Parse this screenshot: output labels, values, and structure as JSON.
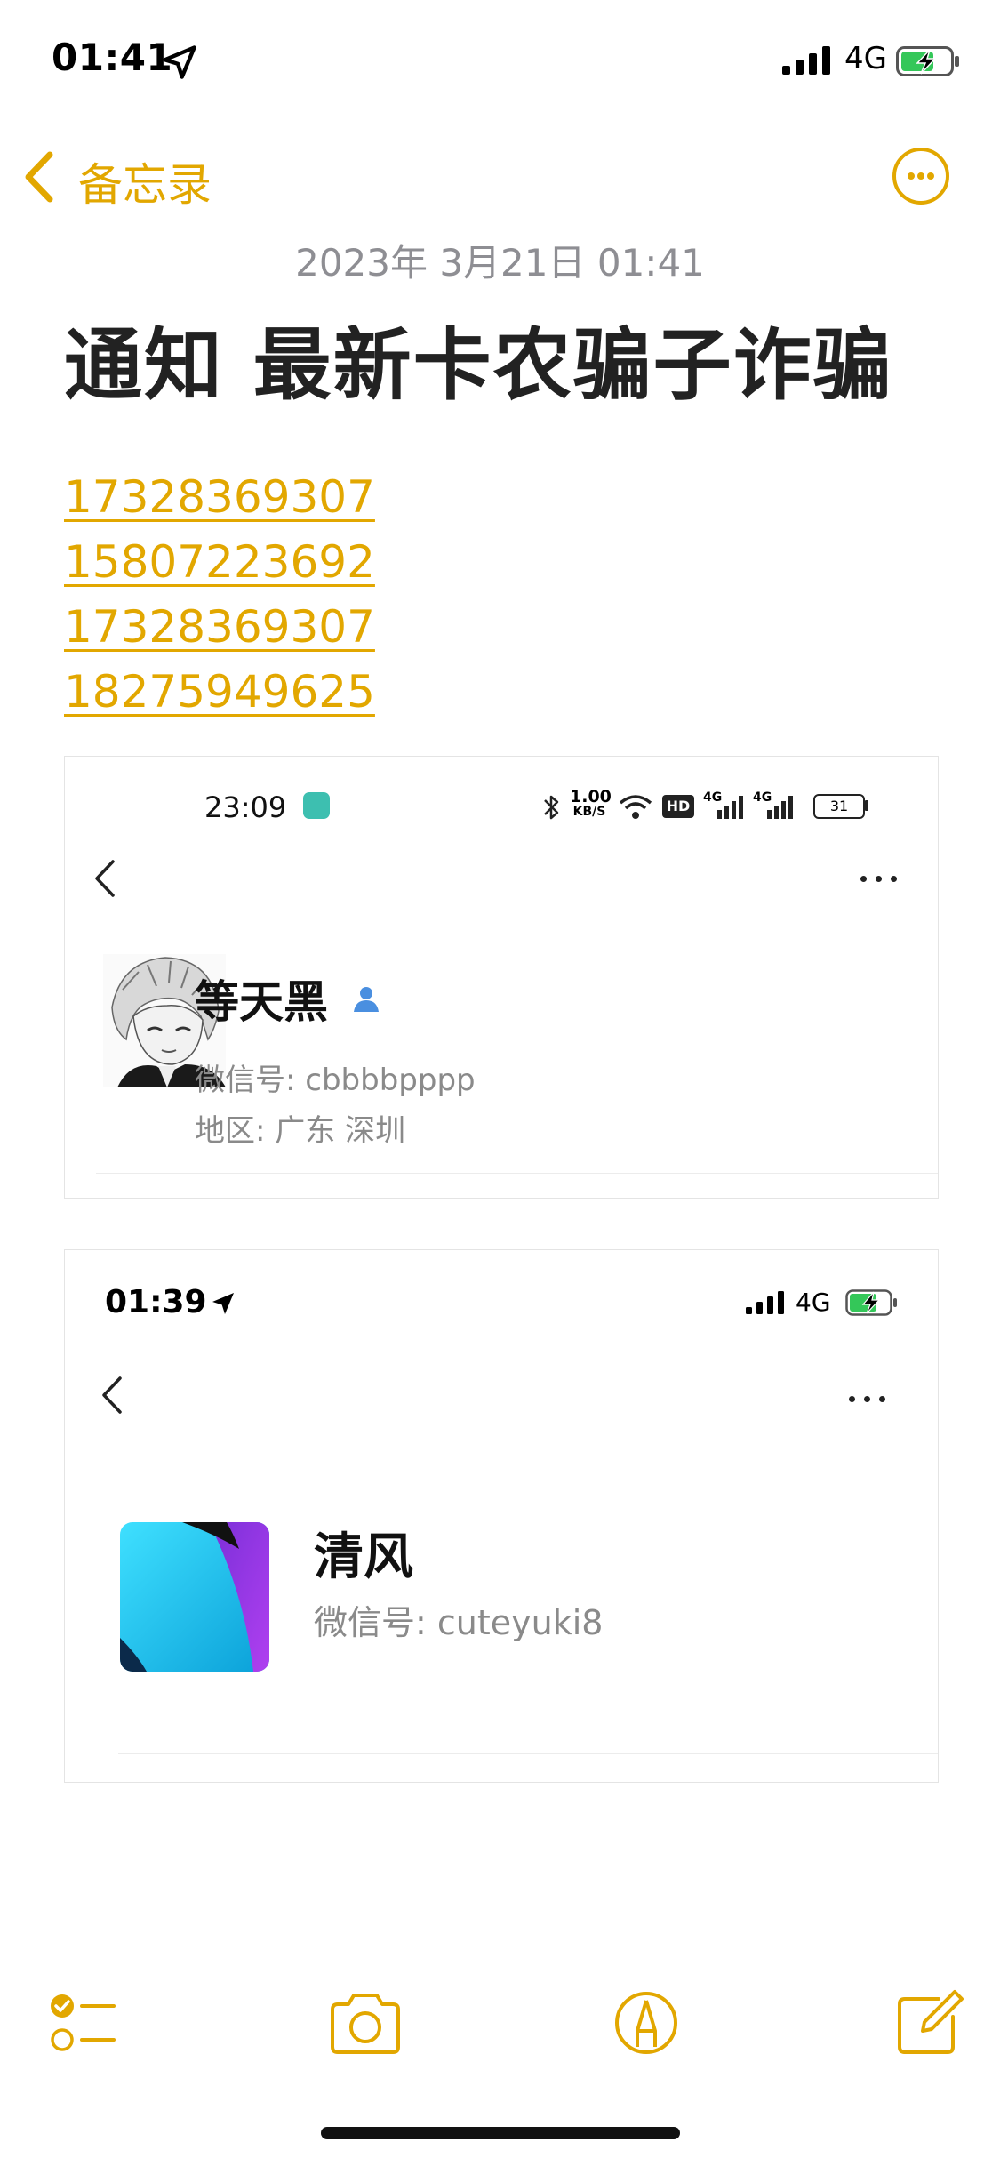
{
  "status_bar": {
    "time": "01:41",
    "network": "4G"
  },
  "nav": {
    "back_label": "备忘录"
  },
  "note": {
    "date": "2023年 3月21日 01:41",
    "title": "通知 最新卡农骗子诈骗",
    "phones": [
      "17328369307",
      "15807223692",
      "17328369307",
      "18275949625"
    ]
  },
  "card1": {
    "time": "23:09",
    "speed_top": "1.00",
    "speed_bottom": "KB/S",
    "hd": "HD",
    "sig1": "4G",
    "sig2": "4G",
    "battery": "31",
    "name": "等天黑",
    "wechat_id": "微信号: cbbbbpppp",
    "region": "地区: 广东  深圳"
  },
  "card2": {
    "time": "01:39",
    "network": "4G",
    "name": "清风",
    "wechat_id": "微信号: cuteyuki8"
  },
  "colors": {
    "accent": "#E2A700",
    "battery_green": "#34C759"
  }
}
